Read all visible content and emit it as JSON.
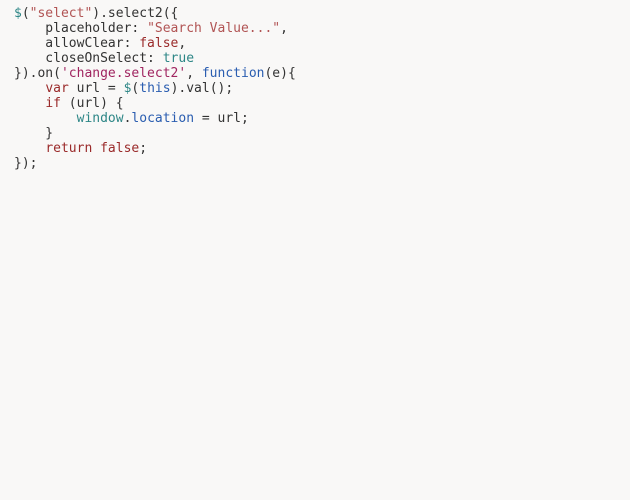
{
  "code": {
    "t1": "$",
    "t2": "(",
    "t3": "\"select\"",
    "t4": ").select2({",
    "t5": "    placeholder: ",
    "t6": "\"Search Value...\"",
    "t7": ",",
    "t8": "    allowClear: ",
    "t9": "false",
    "t10": ",",
    "t11": "    closeOnSelect: ",
    "t12": "true",
    "t13": "}).on(",
    "t14": "'change.select2'",
    "t15": ", ",
    "t16": "function",
    "t17": "(e){",
    "t18": "    ",
    "t19": "var",
    "t20": " url = ",
    "t21": "$",
    "t22": "(",
    "t23": "this",
    "t24": ").val();",
    "t25": "    ",
    "t26": "if",
    "t27": " (url) {",
    "t28": "        ",
    "t29": "window",
    "t30": ".",
    "t31": "location",
    "t32": " = url;",
    "t33": "    }",
    "t34": "    ",
    "t35": "return",
    "t36": " ",
    "t37": "false",
    "t38": ";",
    "t39": "});"
  }
}
